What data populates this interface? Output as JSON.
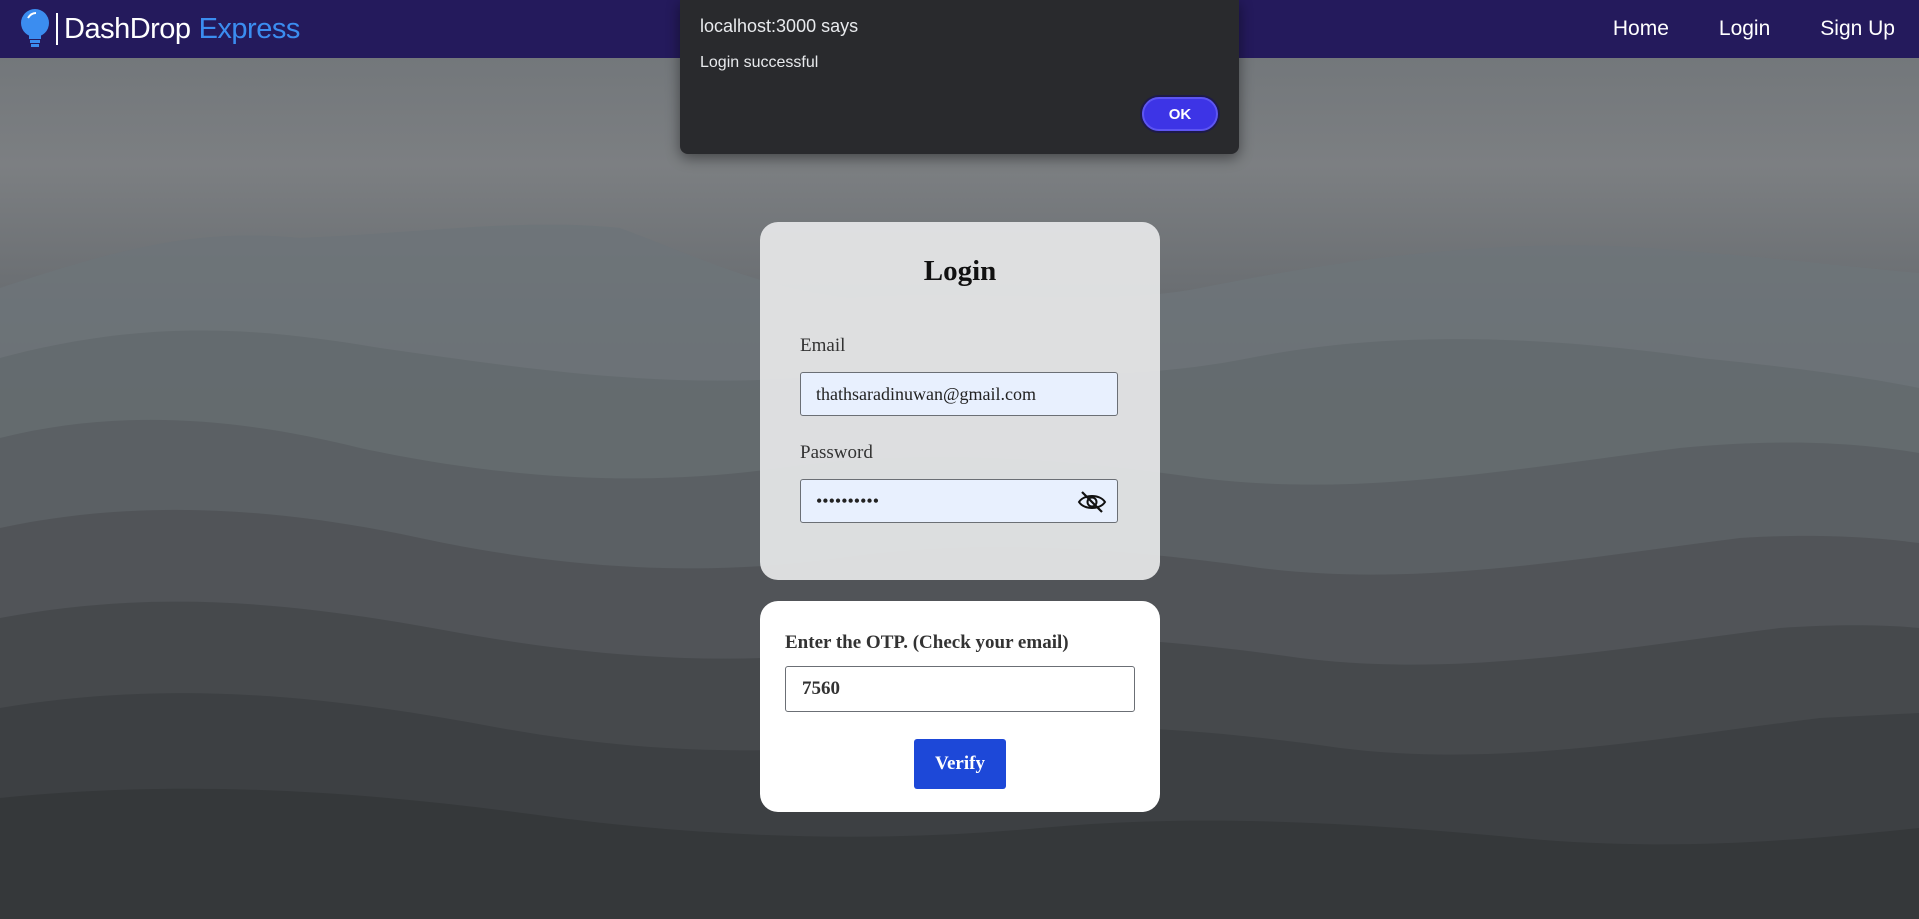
{
  "navbar": {
    "brand_name": "DashDrop",
    "brand_accent": "Express",
    "links": {
      "home": "Home",
      "login": "Login",
      "signup": "Sign Up"
    }
  },
  "alert": {
    "title": "localhost:3000 says",
    "message": "Login successful",
    "ok_label": "OK"
  },
  "login": {
    "title": "Login",
    "email_label": "Email",
    "email_value": "thathsaradinuwan@gmail.com",
    "password_label": "Password",
    "password_value": "••••••••••"
  },
  "otp": {
    "label": "Enter the OTP. (Check your email)",
    "value": "7560",
    "verify_label": "Verify"
  },
  "colors": {
    "navbar_bg": "#241a5c",
    "brand_accent": "#3b8df0",
    "alert_bg": "#292a2d",
    "ok_button": "#3d34e6",
    "verify_button": "#1d48d8",
    "input_autofill_bg": "#e8f0fe"
  },
  "icons": {
    "logo": "lightbulb-icon",
    "password_toggle": "eye-slash-icon"
  }
}
